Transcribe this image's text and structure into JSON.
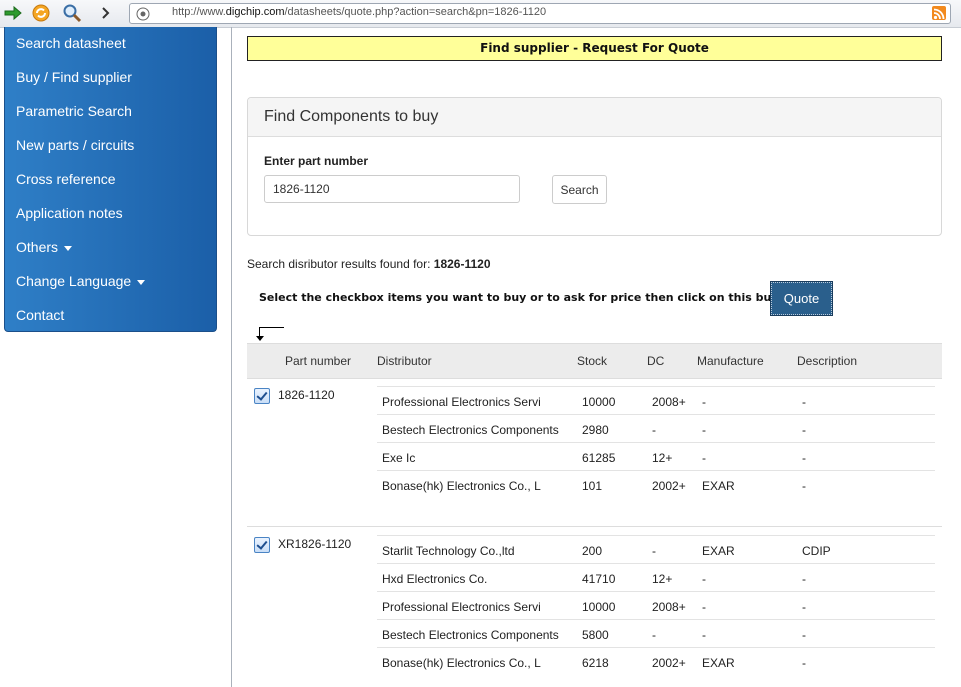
{
  "browser": {
    "url_prefix": "http://www.",
    "url_domain": "digchip.com",
    "url_suffix": "/datasheets/quote.php?action=search&pn=1826-1120"
  },
  "sidebar": {
    "items": [
      {
        "label": "Search datasheet"
      },
      {
        "label": "Buy / Find supplier"
      },
      {
        "label": "Parametric Search"
      },
      {
        "label": "New parts / circuits"
      },
      {
        "label": "Cross reference"
      },
      {
        "label": "Application notes"
      },
      {
        "label": "Others"
      },
      {
        "label": "Change Language"
      },
      {
        "label": "Contact"
      }
    ]
  },
  "banner": "Find supplier - Request For Quote",
  "panel": {
    "title": "Find Components to buy",
    "field_label": "Enter part number",
    "input_value": "1826-1120",
    "search_label": "Search"
  },
  "results": {
    "found_text": "Search disributor results found for:",
    "found_pn": "1826-1120",
    "instruction": "Select the checkbox items you want to buy or to ask for price then click on this button =>",
    "quote_label": "Quote"
  },
  "table": {
    "headers": [
      "Part number",
      "Distributor",
      "Stock",
      "DC",
      "Manufacture",
      "Description"
    ],
    "groups": [
      {
        "part": "1826-1120",
        "rows": [
          [
            "Professional Electronics Servi",
            "10000",
            "2008+",
            "-",
            "-"
          ],
          [
            "Bestech Electronics Components",
            "2980",
            "-",
            "-",
            "-"
          ],
          [
            "Exe Ic",
            "61285",
            "12+",
            "-",
            "-"
          ],
          [
            "Bonase(hk) Electronics Co., L",
            "101",
            "2002+",
            "EXAR",
            "-"
          ]
        ]
      },
      {
        "part": "XR1826-1120",
        "rows": [
          [
            "Starlit Technology Co.,ltd",
            "200",
            "-",
            "EXAR",
            "CDIP"
          ],
          [
            "Hxd Electronics Co.",
            "41710",
            "12+",
            "-",
            "-"
          ],
          [
            "Professional Electronics Servi",
            "10000",
            "2008+",
            "-",
            "-"
          ],
          [
            "Bestech Electronics Components",
            "5800",
            "-",
            "-",
            "-"
          ],
          [
            "Bonase(hk) Electronics Co., L",
            "6218",
            "2002+",
            "EXAR",
            "-"
          ]
        ]
      }
    ]
  }
}
